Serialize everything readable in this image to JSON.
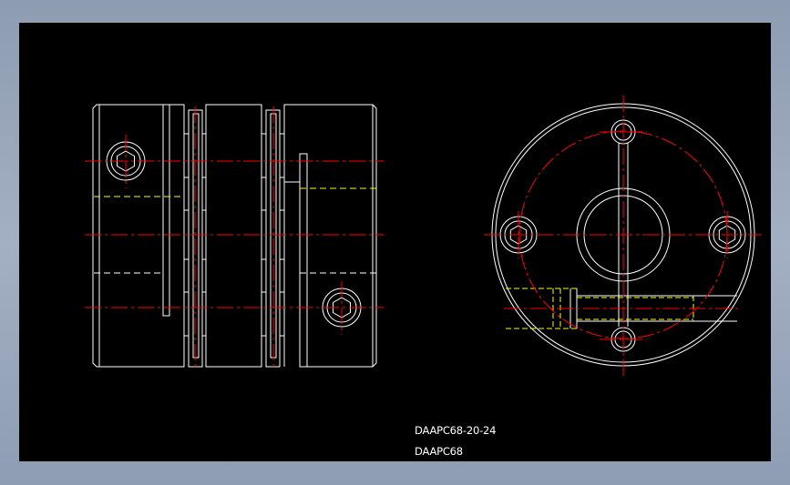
{
  "colors": {
    "background": "#000000",
    "outline": "#ffffff",
    "centerline": "#ff0000",
    "hidden_line": "#ffff00",
    "frame_outer": "#9aa8bc"
  },
  "drawing": {
    "views": [
      "side-view",
      "end-view"
    ],
    "linetypes": [
      "continuous",
      "center",
      "hidden"
    ]
  },
  "title_block": {
    "part_number": "DAAPC68-20-24",
    "series": "DAAPC68"
  }
}
